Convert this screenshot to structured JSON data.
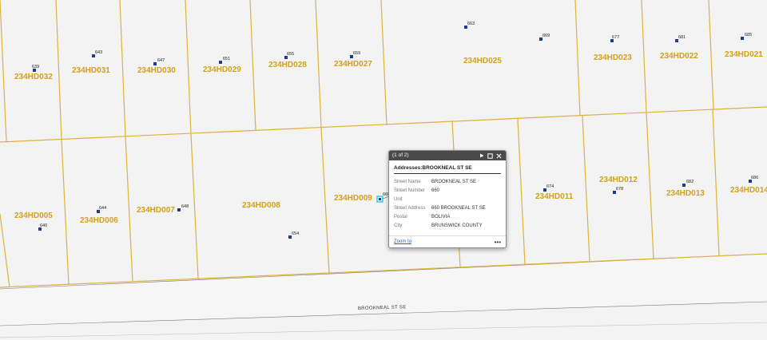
{
  "map": {
    "parcels": [
      {
        "id": "234HD032"
      },
      {
        "id": "234HD031"
      },
      {
        "id": "234HD030"
      },
      {
        "id": "234HD029"
      },
      {
        "id": "234HD028"
      },
      {
        "id": "234HD027"
      },
      {
        "id": "234HD025"
      },
      {
        "id": "234HD023"
      },
      {
        "id": "234HD022"
      },
      {
        "id": "234HD021"
      },
      {
        "id": "234HD005"
      },
      {
        "id": "234HD006"
      },
      {
        "id": "234HD007"
      },
      {
        "id": "234HD008"
      },
      {
        "id": "234HD009"
      },
      {
        "id": "234HD011"
      },
      {
        "id": "234HD012"
      },
      {
        "id": "234HD013"
      },
      {
        "id": "234HD014"
      }
    ],
    "addresses": [
      {
        "num": "639"
      },
      {
        "num": "643"
      },
      {
        "num": "647"
      },
      {
        "num": "651"
      },
      {
        "num": "655"
      },
      {
        "num": "659"
      },
      {
        "num": "663"
      },
      {
        "num": "669"
      },
      {
        "num": "677"
      },
      {
        "num": "681"
      },
      {
        "num": "685"
      },
      {
        "num": "640"
      },
      {
        "num": "644"
      },
      {
        "num": "648"
      },
      {
        "num": "654"
      },
      {
        "num": "674"
      },
      {
        "num": "678"
      },
      {
        "num": "682"
      },
      {
        "num": "686"
      }
    ],
    "selected_address": "660",
    "road_name": "BROOKNEAL ST SE",
    "parcel_line_color": "#e0b13c",
    "parcel_label_color": "#d4a017",
    "point_color": "#1f3b8c",
    "selected_color": "#3cc7e6"
  },
  "popup": {
    "count_label": "(1 of 2)",
    "title": "Addresses:BROOKNEAL ST SE",
    "fields": [
      {
        "key": "Street Name",
        "value": "BROOKNEAL ST SE"
      },
      {
        "key": "Street Number",
        "value": "660"
      },
      {
        "key": "Unit",
        "value": ""
      },
      {
        "key": "Street Address",
        "value": "660 BROOKNEAL ST SE"
      },
      {
        "key": "Postal",
        "value": "BOLIVIA"
      },
      {
        "key": "City",
        "value": "BRUNSWICK COUNTY"
      }
    ],
    "zoom_label": "Zoom to",
    "more_label": "•••",
    "next_icon": "play-icon",
    "maximize_icon": "maximize-icon",
    "close_icon": "close-icon"
  }
}
